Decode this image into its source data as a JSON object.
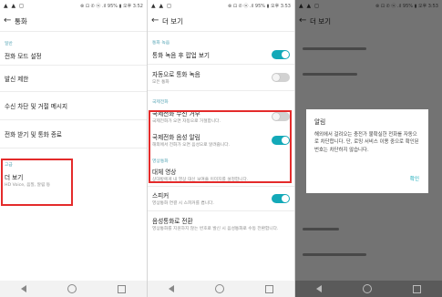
{
  "status": {
    "icons": "▲ ▲ ◻",
    "right": "⊗ ⊡ ✆ ⓦ .il 95% ▮ 오후 3:52",
    "right2": "⊗ ⊡ ✆ ⓦ .il 95% ▮ 오후 3:53"
  },
  "screen1": {
    "title": "통화",
    "section_general": "일반",
    "items": [
      "전화 모드 설정",
      "발신 제한",
      "수신 차단 및 거절 메시지",
      "전화 받기 및 통화 종료"
    ],
    "section_advanced": "고급",
    "more": {
      "label": "더 보기",
      "sub": "HD Voice, 음질, 알림 등"
    }
  },
  "screen2": {
    "title": "더 보기",
    "section_record": "통화 녹음",
    "record_after": "통화 녹음 후 팝업 보기",
    "auto_record": {
      "label": "자동으로 통화 녹음",
      "sub": "모든 통화"
    },
    "section_intl": "국제전화",
    "intl_reject": {
      "label": "국제전화 수신 거부",
      "sub": "국제전화가 오면 자동으로 거절합니다."
    },
    "intl_alert": {
      "label": "국제전화 음성 알림",
      "sub": "해외에서 전화가 오면 음성으로 알려줍니다."
    },
    "section_video": "영상통화",
    "alt_video": {
      "label": "대체 영상",
      "sub": "상대방에게 내 영상 대신 보여줄 이미지를 설정합니다."
    },
    "speaker": {
      "label": "스피커",
      "sub": "영상통화 연결 시 스피커를 켭니다."
    },
    "voice_to_video": {
      "label": "음성통화로 전환",
      "sub": "영상통화를 지원하지 않는 번호로 발신 시 음성통화로 수동 전환합니다."
    }
  },
  "dialog": {
    "title": "알림",
    "message": "해외에서 걸려오는 충전가 불확실한 전화를 자동으로 차단합니다. 단, 로밍 서비스 이용 중으로 확인된 번호는 차단하지 않습니다.",
    "confirm": "확인"
  },
  "colors": {
    "accent": "#13a9b8",
    "highlight": "#e42b2b"
  },
  "icons": {
    "back": "arrow-left-icon",
    "nav": [
      "nav-back-icon",
      "nav-home-icon",
      "nav-recent-icon"
    ]
  }
}
